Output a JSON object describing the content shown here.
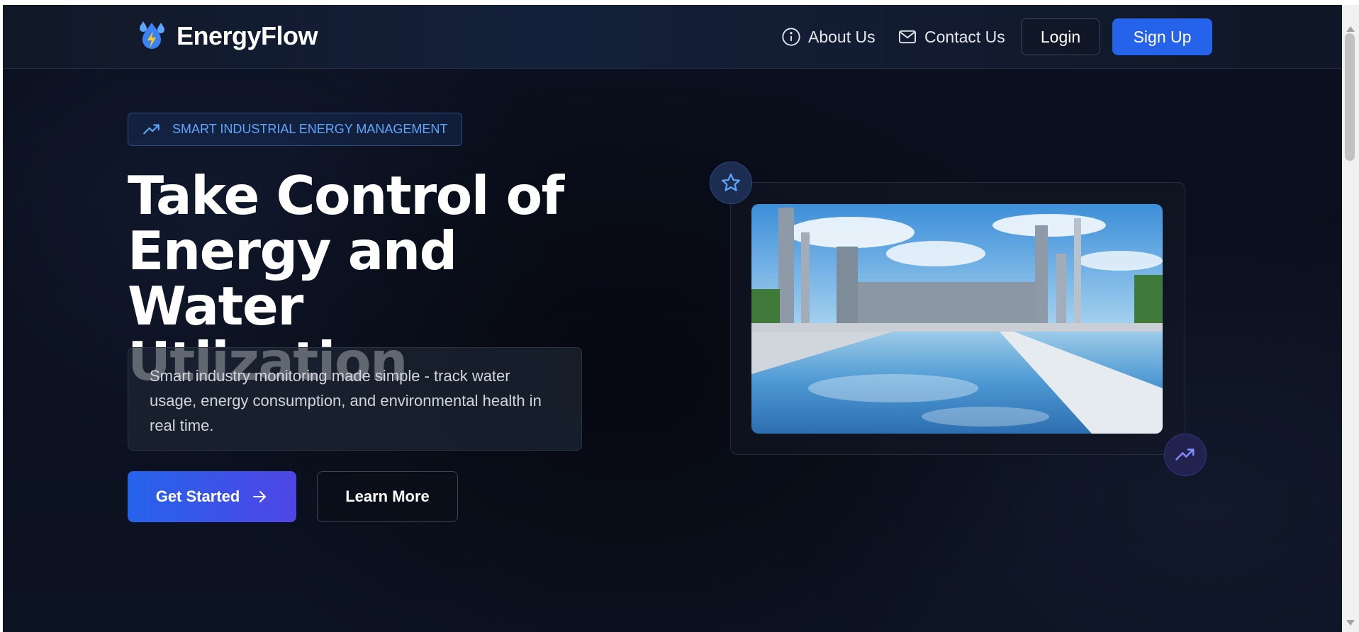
{
  "header": {
    "brand": "EnergyFlow",
    "nav": {
      "about": "About Us",
      "contact": "Contact Us",
      "login": "Login",
      "signup": "Sign Up"
    }
  },
  "hero": {
    "badge": "SMART INDUSTRIAL ENERGY MANAGEMENT",
    "title_line1": "Take Control of",
    "title_line2": "Energy and Water",
    "title_line3": "Utlization",
    "description": "Smart industry monitoring made simple - track water usage, energy consumption, and environmental health in real time.",
    "cta_primary": "Get Started",
    "cta_secondary": "Learn More"
  },
  "icons": {
    "logo": "water-drops-lightning-icon",
    "about": "info-circle-icon",
    "contact": "mail-icon",
    "badge": "trending-up-icon",
    "cta_primary": "arrow-right-icon",
    "image_top_badge": "star-icon",
    "image_bottom_badge": "trending-up-icon"
  },
  "colors": {
    "accent": "#2563eb",
    "badge_text": "#60a5fa",
    "background": "#0b1120",
    "cta_gradient_end": "#4f46e5"
  }
}
